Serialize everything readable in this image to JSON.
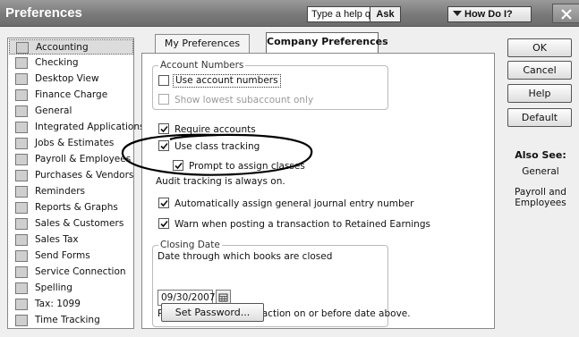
{
  "window": {
    "title": "Preferences",
    "close_glyph": "close-icon"
  },
  "help": {
    "question_placeholder": "Type a help question",
    "ask_label": "Ask",
    "how_do_i_label": "How Do I?"
  },
  "sidebar": {
    "items": [
      {
        "label": "Accounting",
        "icon": "accounting-icon",
        "selected": true
      },
      {
        "label": "Checking",
        "icon": "checking-icon"
      },
      {
        "label": "Desktop View",
        "icon": "desktop-view-icon"
      },
      {
        "label": "Finance Charge",
        "icon": "finance-charge-icon"
      },
      {
        "label": "General",
        "icon": "general-icon"
      },
      {
        "label": "Integrated Applications",
        "icon": "integrated-applications-icon"
      },
      {
        "label": "Jobs & Estimates",
        "icon": "jobs-estimates-icon"
      },
      {
        "label": "Payroll & Employees",
        "icon": "payroll-employees-icon"
      },
      {
        "label": "Purchases & Vendors",
        "icon": "purchases-vendors-icon"
      },
      {
        "label": "Reminders",
        "icon": "reminders-icon"
      },
      {
        "label": "Reports & Graphs",
        "icon": "reports-graphs-icon"
      },
      {
        "label": "Sales & Customers",
        "icon": "sales-customers-icon"
      },
      {
        "label": "Sales Tax",
        "icon": "sales-tax-icon"
      },
      {
        "label": "Send Forms",
        "icon": "send-forms-icon"
      },
      {
        "label": "Service Connection",
        "icon": "service-connection-icon"
      },
      {
        "label": "Spelling",
        "icon": "spelling-icon"
      },
      {
        "label": "Tax: 1099",
        "icon": "tax-1099-icon"
      },
      {
        "label": "Time Tracking",
        "icon": "time-tracking-icon"
      }
    ]
  },
  "tabs": [
    {
      "label": "My Preferences",
      "active": false
    },
    {
      "label": "Company Preferences",
      "active": true
    }
  ],
  "account_numbers": {
    "group_title": "Account Numbers",
    "use_account_numbers": {
      "label": "Use account numbers",
      "checked": false
    },
    "show_lowest_subaccount": {
      "label": "Show lowest subaccount only",
      "checked": false,
      "disabled": true
    }
  },
  "options": {
    "require_accounts": {
      "label": "Require accounts",
      "checked": true
    },
    "use_class_tracking": {
      "label": "Use class tracking",
      "checked": true
    },
    "prompt_assign_classes": {
      "label": "Prompt to assign classes",
      "checked": true
    },
    "audit_note": "Audit tracking is always on.",
    "auto_journal_number": {
      "label": "Automatically assign general journal entry number",
      "checked": true
    },
    "warn_retained_earnings": {
      "label": "Warn when posting a transaction to Retained Earnings",
      "checked": true
    }
  },
  "closing_date": {
    "group_title": "Closing Date",
    "date_label": "Date through which books are closed",
    "date_value": "09/30/2007",
    "password_note": "Password to edit transaction on or before date above.",
    "set_password_label": "Set Password..."
  },
  "right_panel": {
    "ok_label": "OK",
    "cancel_label": "Cancel",
    "help_label": "Help",
    "default_label": "Default",
    "also_see_title": "Also See:",
    "also_see_links": [
      "General",
      "Payroll and Employees"
    ]
  },
  "colors": {
    "titlebar": "#7a7a7a",
    "panel_bg": "#ffffff",
    "window_bg": "#efefef",
    "annotation": "#000000"
  }
}
